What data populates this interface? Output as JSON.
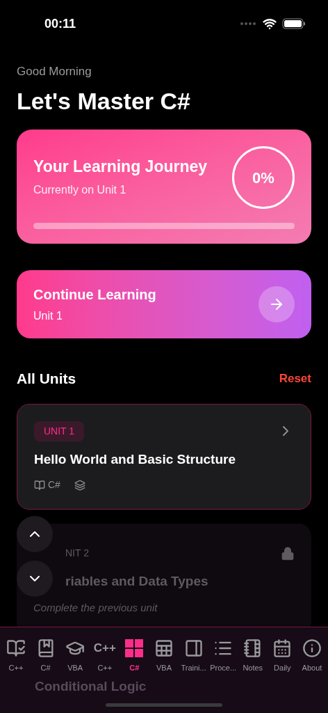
{
  "status_bar": {
    "time": "00:11"
  },
  "header": {
    "greeting": "Good Morning",
    "title": "Let's Master C#"
  },
  "journey": {
    "title": "Your Learning Journey",
    "subtitle": "Currently on Unit 1",
    "percent": "0%",
    "level": 0
  },
  "continue": {
    "title": "Continue Learning",
    "subtitle": "Unit 1"
  },
  "units_section": {
    "title": "All Units",
    "action": "Reset"
  },
  "units": [
    {
      "kind": "open",
      "badge": "UNIT 1",
      "title": "Hello World and Basic Structure",
      "language": "C#"
    },
    {
      "kind": "locked",
      "badge": "NIT 2",
      "title": "riables and Data Types",
      "note": "Complete the previous unit"
    }
  ],
  "tab_bar": [
    {
      "kind": "reader",
      "label": "C++",
      "selected": false
    },
    {
      "kind": "book-cap",
      "label": "C#",
      "selected": false
    },
    {
      "kind": "cap",
      "label": "VBA",
      "selected": false
    },
    {
      "kind": "glyph",
      "glyph": "C++",
      "label": "C++",
      "selected": false
    },
    {
      "kind": "grid",
      "label": "C#",
      "selected": true
    },
    {
      "kind": "sheet",
      "label": "VBA",
      "selected": false
    },
    {
      "kind": "panel",
      "label": "Traini...",
      "selected": false
    },
    {
      "kind": "list",
      "label": "Proce...",
      "selected": false
    },
    {
      "kind": "notebook",
      "label": "Notes",
      "selected": false
    },
    {
      "kind": "calendar",
      "label": "Daily",
      "selected": false
    },
    {
      "kind": "info",
      "label": "About",
      "selected": false
    }
  ],
  "behind_tab_bar": {
    "title": "Conditional Logic"
  }
}
